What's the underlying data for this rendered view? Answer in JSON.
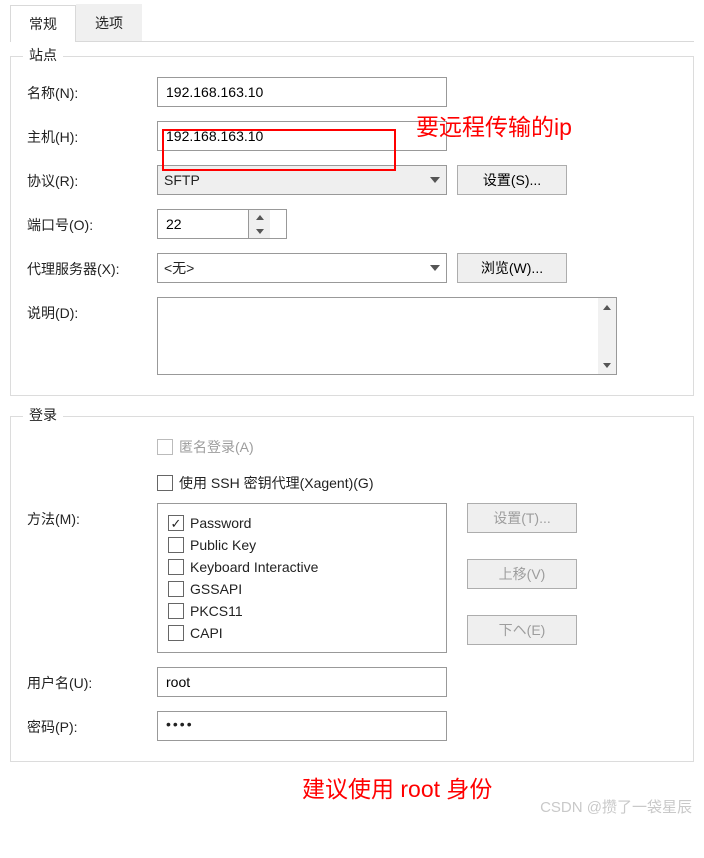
{
  "tabs": {
    "general": "常规",
    "options": "选项"
  },
  "site": {
    "legend": "站点",
    "name_label": "名称(N):",
    "name_value": "192.168.163.10",
    "host_label": "主机(H):",
    "host_value": "192.168.163.10",
    "protocol_label": "协议(R):",
    "protocol_value": "SFTP",
    "settings_btn": "设置(S)...",
    "port_label": "端口号(O):",
    "port_value": "22",
    "proxy_label": "代理服务器(X):",
    "proxy_value": "<无>",
    "browse_btn": "浏览(W)...",
    "desc_label": "说明(D):"
  },
  "login": {
    "legend": "登录",
    "anonymous": "匿名登录(A)",
    "ssh_agent": "使用 SSH 密钥代理(Xagent)(G)",
    "method_label": "方法(M):",
    "methods": [
      {
        "label": "Password",
        "checked": true
      },
      {
        "label": "Public Key",
        "checked": false
      },
      {
        "label": "Keyboard Interactive",
        "checked": false
      },
      {
        "label": "GSSAPI",
        "checked": false
      },
      {
        "label": "PKCS11",
        "checked": false
      },
      {
        "label": "CAPI",
        "checked": false
      }
    ],
    "settings_btn": "设置(T)...",
    "moveup_btn": "上移(V)",
    "movedown_btn": "下ヘ(E)",
    "user_label": "用户名(U):",
    "user_value": "root",
    "password_label": "密码(P):",
    "password_value": "••••"
  },
  "annotations": {
    "ip_note": "要远程传输的ip",
    "root_note": "建议使用 root 身份"
  },
  "watermark": "CSDN @攒了一袋星辰"
}
